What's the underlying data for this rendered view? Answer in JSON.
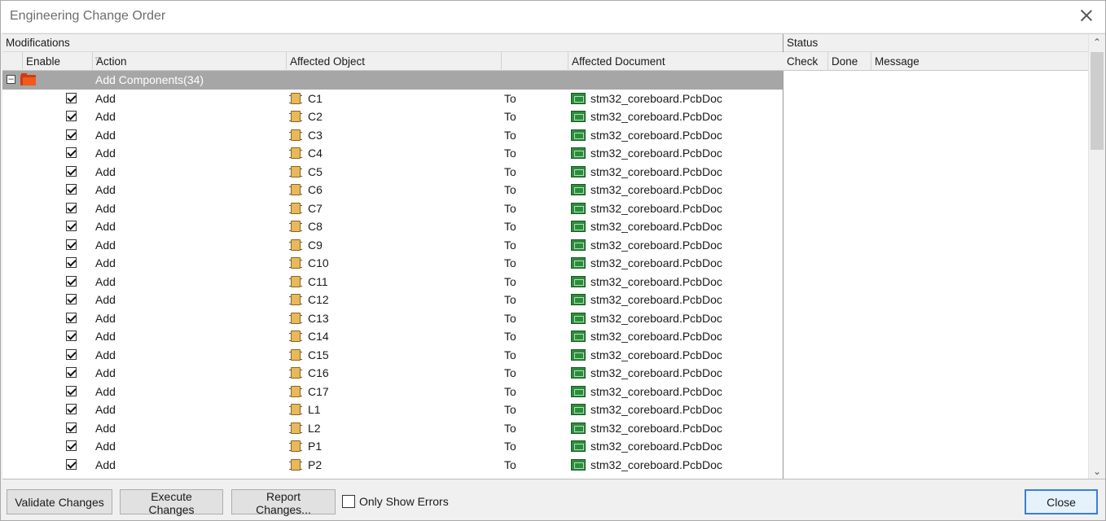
{
  "window": {
    "title": "Engineering Change Order"
  },
  "headers": {
    "modifications": "Modifications",
    "status": "Status",
    "enable": "Enable",
    "action": "Action",
    "affected_object": "Affected Object",
    "affected_document": "Affected Document",
    "check": "Check",
    "done": "Done",
    "message": "Message"
  },
  "group": {
    "label": "Add Components(34)"
  },
  "rows": [
    {
      "action": "Add",
      "object": "C1",
      "to": "To",
      "document": "stm32_coreboard.PcbDoc",
      "enabled": true
    },
    {
      "action": "Add",
      "object": "C2",
      "to": "To",
      "document": "stm32_coreboard.PcbDoc",
      "enabled": true
    },
    {
      "action": "Add",
      "object": "C3",
      "to": "To",
      "document": "stm32_coreboard.PcbDoc",
      "enabled": true
    },
    {
      "action": "Add",
      "object": "C4",
      "to": "To",
      "document": "stm32_coreboard.PcbDoc",
      "enabled": true
    },
    {
      "action": "Add",
      "object": "C5",
      "to": "To",
      "document": "stm32_coreboard.PcbDoc",
      "enabled": true
    },
    {
      "action": "Add",
      "object": "C6",
      "to": "To",
      "document": "stm32_coreboard.PcbDoc",
      "enabled": true
    },
    {
      "action": "Add",
      "object": "C7",
      "to": "To",
      "document": "stm32_coreboard.PcbDoc",
      "enabled": true
    },
    {
      "action": "Add",
      "object": "C8",
      "to": "To",
      "document": "stm32_coreboard.PcbDoc",
      "enabled": true
    },
    {
      "action": "Add",
      "object": "C9",
      "to": "To",
      "document": "stm32_coreboard.PcbDoc",
      "enabled": true
    },
    {
      "action": "Add",
      "object": "C10",
      "to": "To",
      "document": "stm32_coreboard.PcbDoc",
      "enabled": true
    },
    {
      "action": "Add",
      "object": "C11",
      "to": "To",
      "document": "stm32_coreboard.PcbDoc",
      "enabled": true
    },
    {
      "action": "Add",
      "object": "C12",
      "to": "To",
      "document": "stm32_coreboard.PcbDoc",
      "enabled": true
    },
    {
      "action": "Add",
      "object": "C13",
      "to": "To",
      "document": "stm32_coreboard.PcbDoc",
      "enabled": true
    },
    {
      "action": "Add",
      "object": "C14",
      "to": "To",
      "document": "stm32_coreboard.PcbDoc",
      "enabled": true
    },
    {
      "action": "Add",
      "object": "C15",
      "to": "To",
      "document": "stm32_coreboard.PcbDoc",
      "enabled": true
    },
    {
      "action": "Add",
      "object": "C16",
      "to": "To",
      "document": "stm32_coreboard.PcbDoc",
      "enabled": true
    },
    {
      "action": "Add",
      "object": "C17",
      "to": "To",
      "document": "stm32_coreboard.PcbDoc",
      "enabled": true
    },
    {
      "action": "Add",
      "object": "L1",
      "to": "To",
      "document": "stm32_coreboard.PcbDoc",
      "enabled": true
    },
    {
      "action": "Add",
      "object": "L2",
      "to": "To",
      "document": "stm32_coreboard.PcbDoc",
      "enabled": true
    },
    {
      "action": "Add",
      "object": "P1",
      "to": "To",
      "document": "stm32_coreboard.PcbDoc",
      "enabled": true
    },
    {
      "action": "Add",
      "object": "P2",
      "to": "To",
      "document": "stm32_coreboard.PcbDoc",
      "enabled": true
    }
  ],
  "footer": {
    "validate": "Validate Changes",
    "execute": "Execute Changes",
    "report": "Report Changes...",
    "only_errors": "Only Show Errors",
    "close": "Close"
  },
  "icons": {
    "group": "folder-icon",
    "component": "component-icon",
    "document": "pcb-document-icon",
    "expand": "collapse-icon",
    "close": "close-icon",
    "filter": "filter-icon"
  },
  "colors": {
    "group_row": "#a6a6a6",
    "default_button_border": "#3b7ed6"
  }
}
